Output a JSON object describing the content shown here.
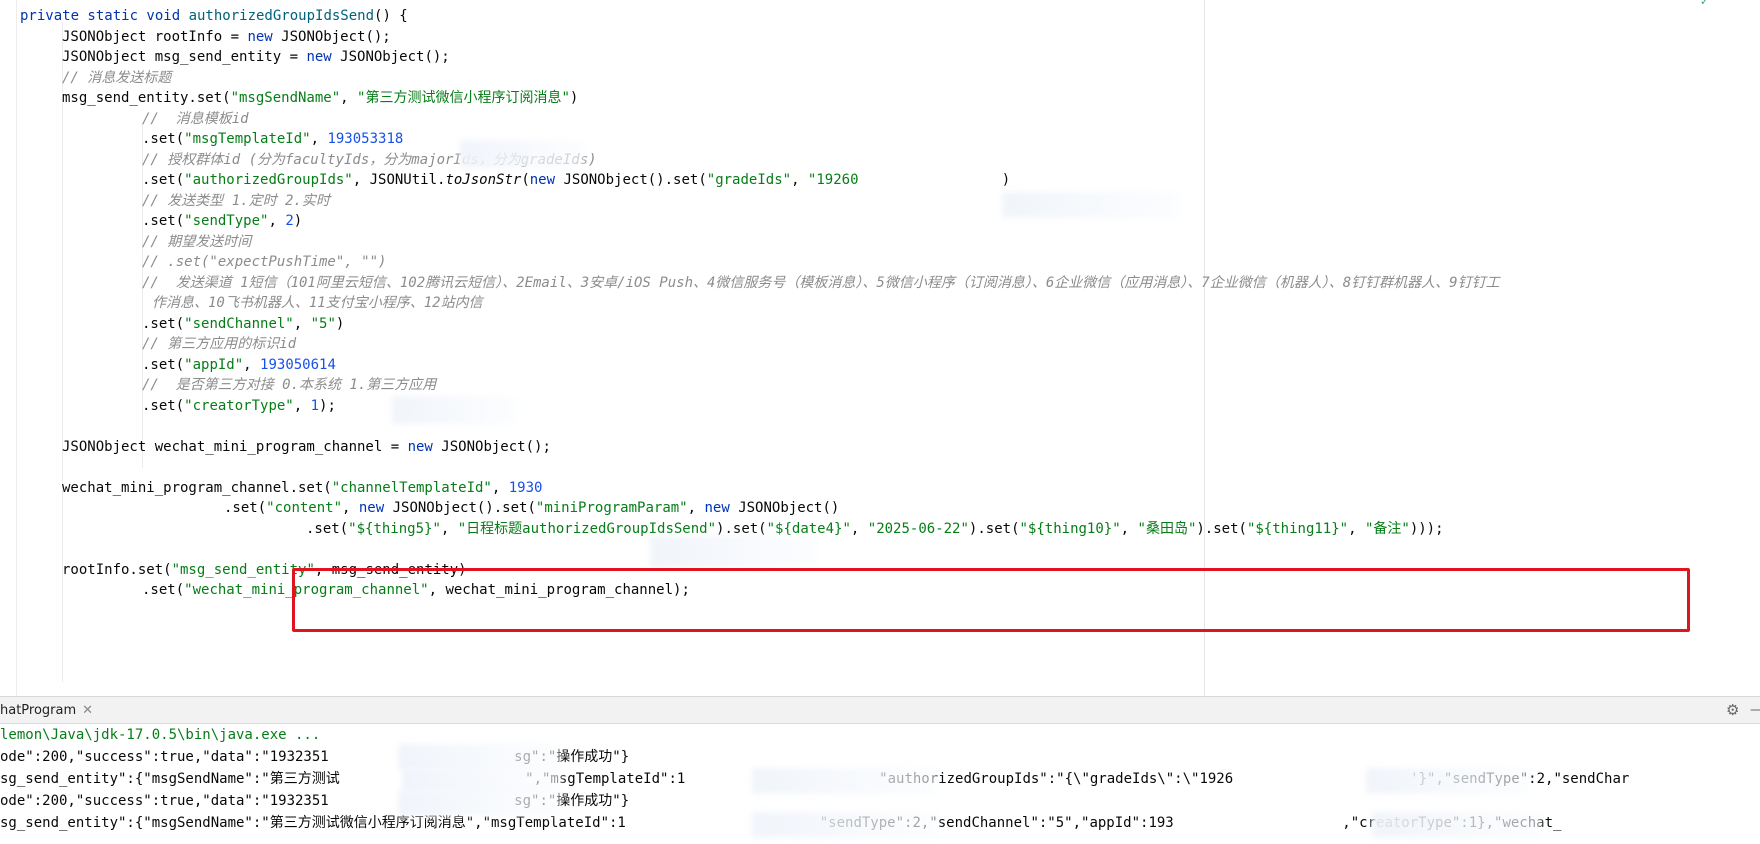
{
  "editor": {
    "lines": [
      {
        "indent": 20,
        "tokens": [
          [
            "kw",
            "private static void "
          ],
          [
            "mth",
            "authorizedGroupIdsSend"
          ],
          [
            "",
            "() {"
          ]
        ]
      },
      {
        "indent": 62,
        "tokens": [
          [
            "",
            "JSONObject rootInfo = "
          ],
          [
            "kw",
            "new "
          ],
          [
            "",
            "JSONObject();"
          ]
        ]
      },
      {
        "indent": 62,
        "tokens": [
          [
            "",
            "JSONObject msg_send_entity = "
          ],
          [
            "kw",
            "new "
          ],
          [
            "",
            "JSONObject();"
          ]
        ]
      },
      {
        "indent": 62,
        "tokens": [
          [
            "cmt",
            "// 消息发送标题"
          ]
        ]
      },
      {
        "indent": 62,
        "tokens": [
          [
            "",
            "msg_send_entity.set("
          ],
          [
            "str",
            "\"msgSendName\""
          ],
          [
            "",
            ", "
          ],
          [
            "str",
            "\"第三方测试微信小程序订阅消息\""
          ],
          [
            "",
            ")"
          ]
        ]
      },
      {
        "indent": 142,
        "tokens": [
          [
            "cmt",
            "//  消息模板id"
          ]
        ]
      },
      {
        "indent": 142,
        "tokens": [
          [
            "",
            ".set("
          ],
          [
            "str",
            "\"msgTemplateId\""
          ],
          [
            "",
            ", "
          ],
          [
            "num",
            "193053318"
          ]
        ]
      },
      {
        "indent": 142,
        "tokens": [
          [
            "cmt",
            "// 授权群体id (分为facultyIds，分为majorIds，分为gradeIds)"
          ]
        ]
      },
      {
        "indent": 142,
        "tokens": [
          [
            "",
            ".set("
          ],
          [
            "str",
            "\"authorizedGroupIds\""
          ],
          [
            "",
            ", JSONUtil."
          ],
          [
            "sttc",
            "toJsonStr"
          ],
          [
            "",
            "("
          ],
          [
            "kw",
            "new "
          ],
          [
            "",
            "JSONObject().set("
          ],
          [
            "str",
            "\"gradeIds\""
          ],
          [
            "",
            ", "
          ],
          [
            "str",
            "\"19260                 "
          ],
          [
            "",
            ")"
          ]
        ]
      },
      {
        "indent": 142,
        "tokens": [
          [
            "cmt",
            "// 发送类型 1.定时 2.实时"
          ]
        ]
      },
      {
        "indent": 142,
        "tokens": [
          [
            "",
            ".set("
          ],
          [
            "str",
            "\"sendType\""
          ],
          [
            "",
            ", "
          ],
          [
            "num",
            "2"
          ],
          [
            "",
            ")"
          ]
        ]
      },
      {
        "indent": 142,
        "tokens": [
          [
            "cmt",
            "// 期望发送时间"
          ]
        ]
      },
      {
        "indent": 142,
        "tokens": [
          [
            "cmt",
            "// .set(\"expectPushTime\", \"\")"
          ]
        ]
      },
      {
        "indent": 142,
        "tokens": [
          [
            "cmt",
            "//  发送渠道 1短信（101阿里云短信、102腾讯云短信）、2Email、3安卓/iOS Push、4微信服务号（模板消息）、5微信小程序（订阅消息）、6企业微信（应用消息）、7企业微信（机器人）、8钉钉群机器人、9钉钉工"
          ]
        ]
      },
      {
        "indent": 152,
        "tokens": [
          [
            "cmt",
            "作消息、10飞书机器人、11支付宝小程序、12站内信"
          ]
        ]
      },
      {
        "indent": 142,
        "tokens": [
          [
            "",
            ".set("
          ],
          [
            "str",
            "\"sendChannel\""
          ],
          [
            "",
            ", "
          ],
          [
            "str",
            "\"5\""
          ],
          [
            "",
            ")"
          ]
        ]
      },
      {
        "indent": 142,
        "tokens": [
          [
            "cmt",
            "// 第三方应用的标识id"
          ]
        ]
      },
      {
        "indent": 142,
        "tokens": [
          [
            "",
            ".set("
          ],
          [
            "str",
            "\"appId\""
          ],
          [
            "",
            ", "
          ],
          [
            "num",
            "193050614"
          ]
        ]
      },
      {
        "indent": 142,
        "tokens": [
          [
            "cmt",
            "//  是否第三方对接 0.本系统 1.第三方应用"
          ]
        ]
      },
      {
        "indent": 142,
        "tokens": [
          [
            "",
            ".set("
          ],
          [
            "str",
            "\"creatorType\""
          ],
          [
            "",
            ", "
          ],
          [
            "num",
            "1"
          ],
          [
            "",
            ");"
          ]
        ]
      },
      {
        "indent": 62,
        "tokens": []
      },
      {
        "indent": 62,
        "tokens": [
          [
            "",
            "JSONObject wechat_mini_program_channel = "
          ],
          [
            "kw",
            "new "
          ],
          [
            "",
            "JSONObject();"
          ]
        ]
      },
      {
        "indent": 62,
        "tokens": []
      },
      {
        "indent": 62,
        "tokens": [
          [
            "",
            "wechat_mini_program_channel.set("
          ],
          [
            "str",
            "\"channelTemplateId\""
          ],
          [
            "",
            ", "
          ],
          [
            "num",
            "1930"
          ]
        ]
      },
      {
        "indent": 224,
        "tokens": [
          [
            "",
            ".set("
          ],
          [
            "str",
            "\"content\""
          ],
          [
            "",
            ", "
          ],
          [
            "kw",
            "new "
          ],
          [
            "",
            "JSONObject().set("
          ],
          [
            "str",
            "\"miniProgramParam\""
          ],
          [
            "",
            ", "
          ],
          [
            "kw",
            "new "
          ],
          [
            "",
            "JSONObject()"
          ]
        ]
      },
      {
        "indent": 306,
        "tokens": [
          [
            "",
            ".set("
          ],
          [
            "str",
            "\"${thing5}\""
          ],
          [
            "",
            ", "
          ],
          [
            "str",
            "\"日程标题authorizedGroupIdsSend\""
          ],
          [
            "",
            ").set("
          ],
          [
            "str",
            "\"${date4}\""
          ],
          [
            "",
            ", "
          ],
          [
            "str",
            "\"2025-06-22\""
          ],
          [
            "",
            ").set("
          ],
          [
            "str",
            "\"${thing10}\""
          ],
          [
            "",
            ", "
          ],
          [
            "str",
            "\"桑田岛\""
          ],
          [
            "",
            ").set("
          ],
          [
            "str",
            "\"${thing11}\""
          ],
          [
            "",
            ", "
          ],
          [
            "str",
            "\"备注\""
          ],
          [
            "",
            ")));"
          ]
        ]
      },
      {
        "indent": 62,
        "tokens": []
      },
      {
        "indent": 62,
        "tokens": [
          [
            "",
            "rootInfo.set("
          ],
          [
            "str",
            "\"msg_send_entity\""
          ],
          [
            "",
            ", msg_send_entity)"
          ]
        ]
      },
      {
        "indent": 142,
        "tokens": [
          [
            "",
            ".set("
          ],
          [
            "str",
            "\"wechat_mini_program_channel\""
          ],
          [
            "",
            ", wechat_mini_program_channel);"
          ]
        ]
      }
    ]
  },
  "tool_window": {
    "tab_label": "hatProgram",
    "close_glyph": "✕",
    "settings_glyph": "⚙",
    "minimize_glyph": "—"
  },
  "console": {
    "lines": [
      {
        "cls": "path",
        "text": "lemon\\Java\\jdk-17.0.5\\bin\\java.exe ..."
      },
      {
        "cls": "",
        "text": "ode\":200,\"success\":true,\"data\":\"1932351                      sg\":\"操作成功\"}"
      },
      {
        "cls": "",
        "text": "sg_send_entity\":{\"msgSendName\":\"第三方测试                      \",\"msgTemplateId\":1                       \"authorizedGroupIds\":\"{\\\"gradeIds\\\":\\\"1926                     '}\",\"sendType\":2,\"sendChar"
      },
      {
        "cls": "",
        "text": "ode\":200,\"success\":true,\"data\":\"1932351                      sg\":\"操作成功\"}"
      },
      {
        "cls": "",
        "text": "sg_send_entity\":{\"msgSendName\":\"第三方测试微信小程序订阅消息\",\"msgTemplateId\":1                       \"sendType\":2,\"sendChannel\":\"5\",\"appId\":193                    ,\"creatorType\":1},\"wechat_"
      }
    ]
  }
}
